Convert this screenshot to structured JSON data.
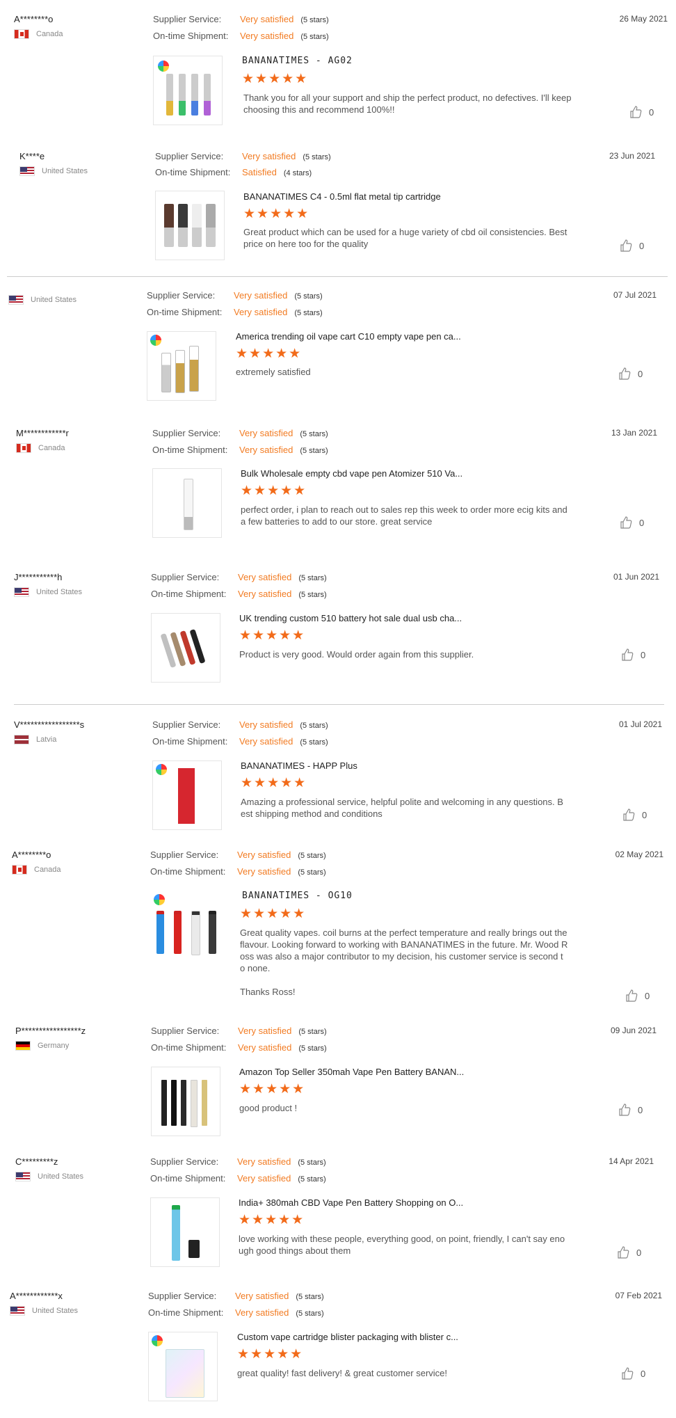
{
  "labels": {
    "supplier": "Supplier Service:",
    "shipment": "On-time Shipment:"
  },
  "colors": {
    "accent": "#f27b22",
    "star": "#f26b1a"
  },
  "reviews": [
    {
      "user": "A********o",
      "country": "Canada",
      "flag": "canada",
      "date": "26 May 2021",
      "supplier": "Very satisfied",
      "supplier_count": "(5 stars)",
      "shipment": "Very satisfied",
      "shipment_count": "(5 stars)",
      "product": "BANANATIMES - AG02",
      "stars": "★★★★★",
      "rating": 5,
      "comment": "Thank you for all your support and ship the perfect product, no defectives. I'll keep\nchoosing this and recommend 100%!!",
      "likes": "0"
    },
    {
      "user": "K****e",
      "country": "United States",
      "flag": "us",
      "date": "23 Jun 2021",
      "supplier": "Very satisfied",
      "supplier_count": "(5 stars)",
      "shipment": "Satisfied",
      "shipment_count": "(4 stars)",
      "product": "BANANATIMES C4 - 0.5ml flat metal tip cartridge",
      "stars": "★★★★★",
      "rating": 5,
      "comment": "Great product which can be used for a huge variety of cbd oil consistencies. Best\nprice on here too for the quality",
      "likes": "0"
    },
    {
      "user": "",
      "country": "United States",
      "flag": "us",
      "date": "07 Jul 2021",
      "supplier": "Very satisfied",
      "supplier_count": "(5 stars)",
      "shipment": "Very satisfied",
      "shipment_count": "(5 stars)",
      "product": "America trending oil vape cart C10 empty vape pen ca...",
      "stars": "★★★★★",
      "rating": 5,
      "comment": "extremely satisfied",
      "likes": "0"
    },
    {
      "user": "M************r",
      "country": "Canada",
      "flag": "canada",
      "date": "13 Jan 2021",
      "supplier": "Very satisfied",
      "supplier_count": "(5 stars)",
      "shipment": "Very satisfied",
      "shipment_count": "(5 stars)",
      "product": "Bulk Wholesale empty cbd vape pen Atomizer 510 Va...",
      "stars": "★★★★★",
      "rating": 5,
      "comment": "perfect order, i plan to reach out to sales rep this week to order more ecig kits and\na few batteries to add to our store. great service",
      "likes": "0"
    },
    {
      "user": "J***********h",
      "country": "United States",
      "flag": "us",
      "date": "01 Jun 2021",
      "supplier": "Very satisfied",
      "supplier_count": "(5 stars)",
      "shipment": "Very satisfied",
      "shipment_count": "(5 stars)",
      "product": "UK trending custom 510 battery hot sale dual usb cha...",
      "stars": "★★★★★",
      "rating": 5,
      "comment": "Product is very good. Would order again from this supplier.",
      "likes": "0"
    },
    {
      "user": "V*****************s",
      "country": "Latvia",
      "flag": "latvia",
      "date": "01 Jul 2021",
      "supplier": "Very satisfied",
      "supplier_count": "(5 stars)",
      "shipment": "Very satisfied",
      "shipment_count": "(5 stars)",
      "product": "BANANATIMES - HAPP Plus",
      "stars": "★★★★★",
      "rating": 5,
      "comment": "Amazing a professional service, helpful polite and welcoming in any questions. B\nest shipping method and conditions",
      "likes": "0"
    },
    {
      "user": "A********o",
      "country": "Canada",
      "flag": "canada",
      "date": "02 May 2021",
      "supplier": "Very satisfied",
      "supplier_count": "(5 stars)",
      "shipment": "Very satisfied",
      "shipment_count": "(5 stars)",
      "product": "BANANATIMES - OG10",
      "stars": "★★★★★",
      "rating": 5,
      "comment": "Great quality vapes. coil burns at the perfect temperature and really brings out the\nflavour. Looking forward to working with BANANATIMES in the future. Mr. Wood R\noss was also a major contributor to my decision, his customer service is second t\no none.\n\nThanks Ross!",
      "likes": "0"
    },
    {
      "user": "P*****************z",
      "country": "Germany",
      "flag": "germany",
      "date": "09 Jun 2021",
      "supplier": "Very satisfied",
      "supplier_count": "(5 stars)",
      "shipment": "Very satisfied",
      "shipment_count": "(5 stars)",
      "product": "Amazon Top Seller 350mah Vape Pen Battery BANAN...",
      "stars": "★★★★★",
      "rating": 5,
      "comment": "good product !",
      "likes": "0"
    },
    {
      "user": "C*********z",
      "country": "United States",
      "flag": "us",
      "date": "14 Apr 2021",
      "supplier": "Very satisfied",
      "supplier_count": "(5 stars)",
      "shipment": "Very satisfied",
      "shipment_count": "(5 stars)",
      "product": "India+ 380mah CBD Vape Pen Battery Shopping on O...",
      "stars": "★★★★★",
      "rating": 5,
      "comment": "love working with these people, everything good, on point, friendly, I can't say eno\nugh good things about them",
      "likes": "0"
    },
    {
      "user": "A************x",
      "country": "United States",
      "flag": "us",
      "date": "07 Feb 2021",
      "supplier": "Very satisfied",
      "supplier_count": "(5 stars)",
      "shipment": "Very satisfied",
      "shipment_count": "(5 stars)",
      "product": "Custom vape cartridge blister packaging with blister c...",
      "stars": "★★★★★",
      "rating": 5,
      "comment": "great quality! fast delivery! & great customer service!",
      "likes": "0"
    }
  ]
}
